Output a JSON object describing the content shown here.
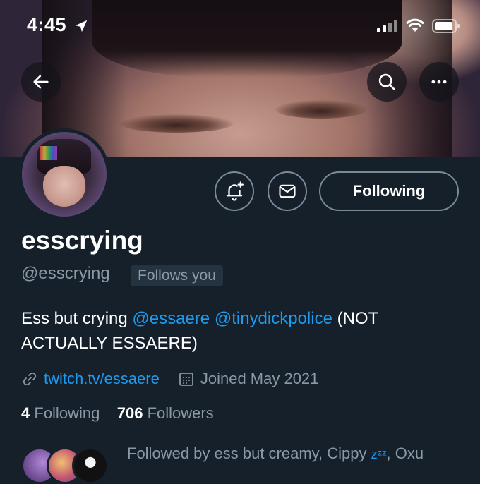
{
  "status_bar": {
    "time": "4:45"
  },
  "header": {
    "back_icon": "arrow-left-icon",
    "search_icon": "search-icon",
    "more_icon": "more-horizontal-icon"
  },
  "profile": {
    "display_name": "esscrying",
    "handle": "@esscrying",
    "follows_you_badge": "Follows you",
    "bio": {
      "prefix": "Ess but crying ",
      "mention1": "@essaere",
      "space": " ",
      "mention2": "@tinydickpolice",
      "suffix": " (NOT ACTUALLY ESSAERE)"
    },
    "link": "twitch.tv/essaere",
    "joined": "Joined May 2021",
    "following_count": "4",
    "following_label": "Following",
    "followers_count": "706",
    "followers_label": "Followers",
    "followed_by_prefix": "Followed by ess but creamy, Cippy ",
    "followed_by_zzz": "zᶻᶻ",
    "followed_by_suffix": ", Oxu"
  },
  "actions": {
    "following_button": "Following"
  },
  "colors": {
    "background": "#15202b",
    "accent": "#1d9bf0",
    "secondary_text": "#8b98a5"
  }
}
